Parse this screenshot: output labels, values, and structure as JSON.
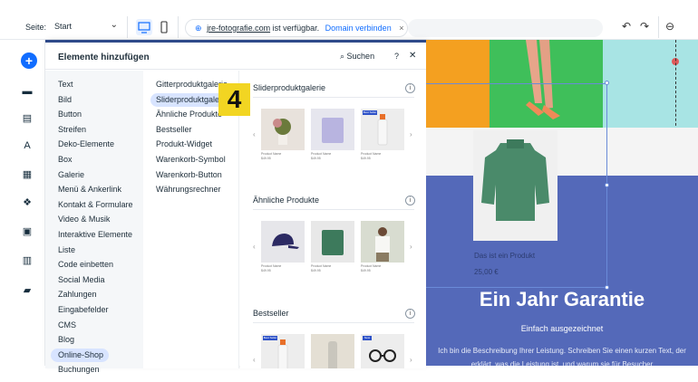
{
  "topbar": {
    "page_label": "Seite:",
    "page_value": "Start",
    "url": {
      "domain": "jre-fotografie.com",
      "status": "ist verfügbar.",
      "connect": "Domain verbinden"
    }
  },
  "panel": {
    "title": "Elemente hinzufügen",
    "search_label": "Suchen",
    "categories": [
      "Text",
      "Bild",
      "Button",
      "Streifen",
      "Deko-Elemente",
      "Box",
      "Galerie",
      "Menü & Ankerlink",
      "Kontakt & Formulare",
      "Video & Musik",
      "Interaktive Elemente",
      "Liste",
      "Code einbetten",
      "Social Media",
      "Zahlungen",
      "Eingabefelder",
      "CMS",
      "Blog",
      "Online-Shop",
      "Buchungen"
    ],
    "selected_category": "Online-Shop",
    "subcategories": [
      "Gitterproduktgalerie",
      "Sliderproduktgalerie",
      "Ähnliche Produkte",
      "Bestseller",
      "Produkt-Widget",
      "Warenkorb-Symbol",
      "Warenkorb-Button",
      "Währungsrechner"
    ],
    "selected_subcategory": "Sliderproduktgalerie",
    "sections": [
      {
        "title": "Sliderproduktgalerie"
      },
      {
        "title": "Ähnliche Produkte"
      },
      {
        "title": "Bestseller"
      }
    ],
    "thumb_caption_name": "Product Name",
    "thumb_caption_price": "$49.95",
    "badge_label": "Best Seller",
    "badge_label_short": "New"
  },
  "step_badge": "4",
  "canvas": {
    "product_name": "Das ist ein Produkt",
    "product_price": "25,00 €",
    "guarantee_title": "Ein Jahr Garantie",
    "guarantee_sub": "Einfach ausgezeichnet",
    "guarantee_desc": "Ich bin die Beschreibung Ihrer Leistung. Schreiben Sie einen kurzen Text, der erklärt, was die Leistung ist, und warum sie für Besucher"
  },
  "colors": {
    "accent": "#116dff",
    "panel_border": "#2e4a8a",
    "selection": "#d8e4ff",
    "canvas_blue": "#5469b9",
    "step_badge": "#f2d522"
  }
}
